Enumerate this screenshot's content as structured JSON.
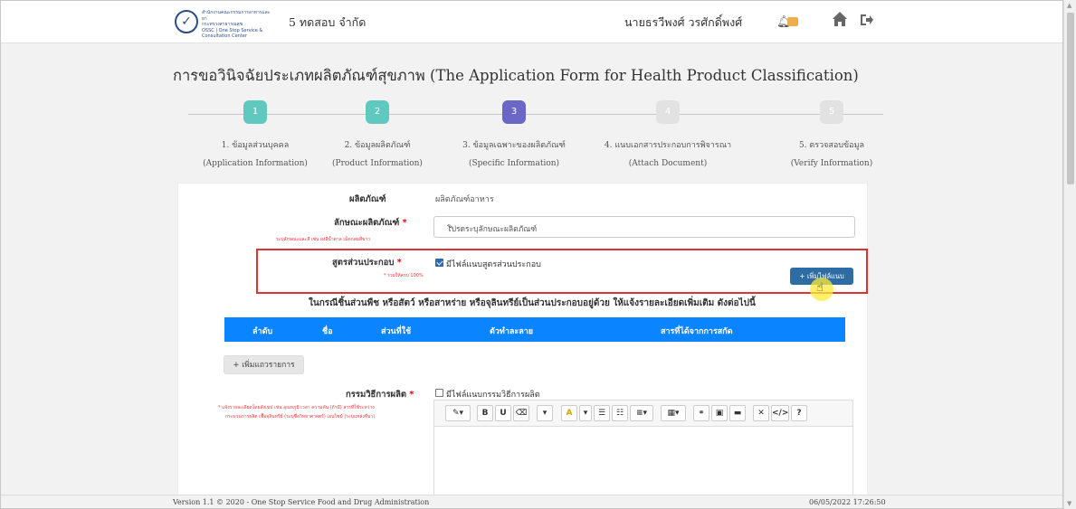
{
  "header": {
    "logo_line1": "สำนักงานคณะกรรมการอาหารและยา",
    "logo_line2": "กระทรวงสาธารณสุข",
    "logo_line3": "OSSC | One Stop Service & Consultation Center",
    "company": "5 ทดสอบ จำกัด",
    "username": "นายธรวีพงศ์ วรศักดิ์พงศ์",
    "notification_count": "",
    "icons": [
      "bell-icon",
      "home-icon",
      "logout-icon"
    ]
  },
  "page_title": "การขอวินิจฉัยประเภทผลิตภัณฑ์สุขภาพ (The Application Form for Health Product Classification)",
  "steps": [
    {
      "num": "1",
      "th": "1. ข้อมูลส่วนบุคคล",
      "en": "(Application Information)",
      "color": "#5fc9c0"
    },
    {
      "num": "2",
      "th": "2. ข้อมูลผลิตภัณฑ์",
      "en": "(Product Information)",
      "color": "#5fc9c0"
    },
    {
      "num": "3",
      "th": "3. ข้อมูลเฉพาะของผลิตภัณฑ์",
      "en": "(Specific Information)",
      "color": "#6b67c7"
    },
    {
      "num": "4",
      "th": "4. แนบเอกสารประกอบการพิจารณา",
      "en": "(Attach Document)",
      "color": "#e2e2e2"
    },
    {
      "num": "5",
      "th": "5. ตรวจสอบข้อมูล",
      "en": "(Verify Information)",
      "color": "#e2e2e2"
    }
  ],
  "form": {
    "product_label": "ผลิตภัณฑ์",
    "product_value": "ผลิตภัณฑ์อาหาร",
    "feature_label": "ลักษณะผลิตภัณฑ์",
    "feature_hint": "ระบุลักษณะและสี เช่น ผงสีน้ำตาล เม็ดกลมสีขาว",
    "feature_placeholder": "โปรดระบุลักษณะผลิตภัณฑ์",
    "formula_label": "สูตรส่วนประกอบ",
    "formula_hint": "* รวมให้ครบ 100%",
    "formula_checkbox": "มีไฟล์แนบสูตรส่วนประกอบ",
    "attach_button": "เพิ่มไฟล์แนบ",
    "notice": "ในกรณีชิ้นส่วนพืช หรือสัตว์ หรือสาหร่าย หรือจุลินทรีย์เป็นส่วนประกอบอยู่ด้วย ให้แจ้งรายละเอียดเพิ่มเติม ดังต่อไปนี้",
    "table_headers": [
      "ลำดับ",
      "ชื่อ",
      "ส่วนที่ใช้",
      "ตัวทำละลาย",
      "สารที่ได้จากการสกัด"
    ],
    "add_row_button": "+ เพิ่มแถวรายการ",
    "process_label": "กรรมวิธีการผลิต",
    "process_hint_1": "* แจ้งรายละเอียดโดยสังเขป เช่น อุณหภูมิ เวลา ความดัน (ถ้ามี) สารที่ใช้ระหว่าง",
    "process_hint_2": "กระบวนการผลิต เชื้อจุลินทรีย์ (ระบุชื่อวิทยาศาสตร์) เอนไซม์ (ระบุแหล่งที่มา)",
    "process_checkbox": "มีไฟล์แนบกรรมวิธีการผลิต"
  },
  "footer": {
    "version": "Version 1.1 © 2020 - One Stop Service Food and Drug Administration",
    "datetime": "06/05/2022 17:26:50"
  }
}
